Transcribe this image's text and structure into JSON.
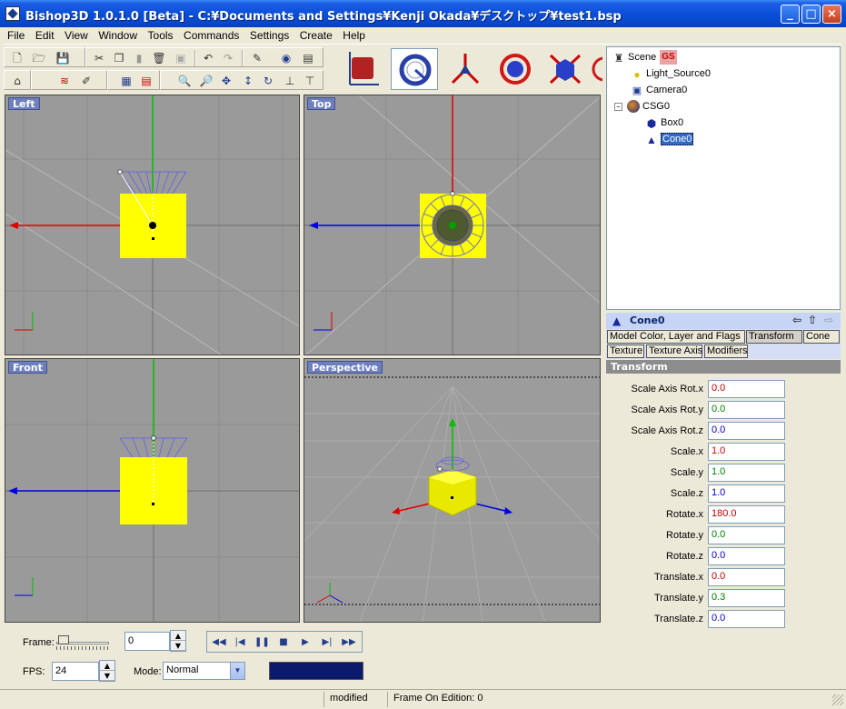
{
  "window": {
    "title": "Bishop3D 1.0.1.0 [Beta] - C:¥Documents and Settings¥Kenji Okada¥デスクトップ¥test1.bsp"
  },
  "menu": [
    "File",
    "Edit",
    "View",
    "Window",
    "Tools",
    "Commands",
    "Settings",
    "Create",
    "Help"
  ],
  "viewports": {
    "left": "Left",
    "top": "Top",
    "front": "Front",
    "perspective": "Perspective"
  },
  "bottom": {
    "frame_label": "Frame:",
    "frame_value": "0",
    "fps_label": "FPS:",
    "fps_value": "24",
    "mode_label": "Mode:",
    "mode_value": "Normal"
  },
  "status": {
    "state": "modified",
    "frame_on_edition": "Frame On Edition: 0"
  },
  "scene_tree": {
    "root": "Scene",
    "badge": "GS",
    "items": [
      {
        "label": "Light_Source0",
        "icon": "lightbulb-icon"
      },
      {
        "label": "Camera0",
        "icon": "camera-icon"
      },
      {
        "label": "CSG0",
        "icon": "csg-icon"
      },
      {
        "label": "Box0",
        "icon": "box-icon"
      },
      {
        "label": "Cone0",
        "icon": "cone-icon"
      }
    ]
  },
  "selected": {
    "name": "Cone0"
  },
  "tabs": [
    "Model Color, Layer and Flags",
    "Transform",
    "Cone",
    "Texture",
    "Texture Axis",
    "Modifiers"
  ],
  "section_title": "Transform",
  "properties": [
    {
      "label": "Scale Axis Rot.x",
      "value": "0.0",
      "color": "#c00000"
    },
    {
      "label": "Scale Axis Rot.y",
      "value": "0.0",
      "color": "#008000"
    },
    {
      "label": "Scale Axis Rot.z",
      "value": "0.0",
      "color": "#0000c0"
    },
    {
      "label": "Scale.x",
      "value": "1.0",
      "color": "#c00000"
    },
    {
      "label": "Scale.y",
      "value": "1.0",
      "color": "#008000"
    },
    {
      "label": "Scale.z",
      "value": "1.0",
      "color": "#0000c0"
    },
    {
      "label": "Rotate.x",
      "value": "180.0",
      "color": "#c00000"
    },
    {
      "label": "Rotate.y",
      "value": "0.0",
      "color": "#008000"
    },
    {
      "label": "Rotate.z",
      "value": "0.0",
      "color": "#0000c0"
    },
    {
      "label": "Translate.x",
      "value": "0.0",
      "color": "#c00000"
    },
    {
      "label": "Translate.y",
      "value": "0.3",
      "color": "#008000"
    },
    {
      "label": "Translate.z",
      "value": "0.0",
      "color": "#0000c0"
    }
  ],
  "colors": {
    "titlebar": "#0a4fd8",
    "object_yellow": "#ffff00",
    "grid_gray": "#9a9a9a"
  }
}
